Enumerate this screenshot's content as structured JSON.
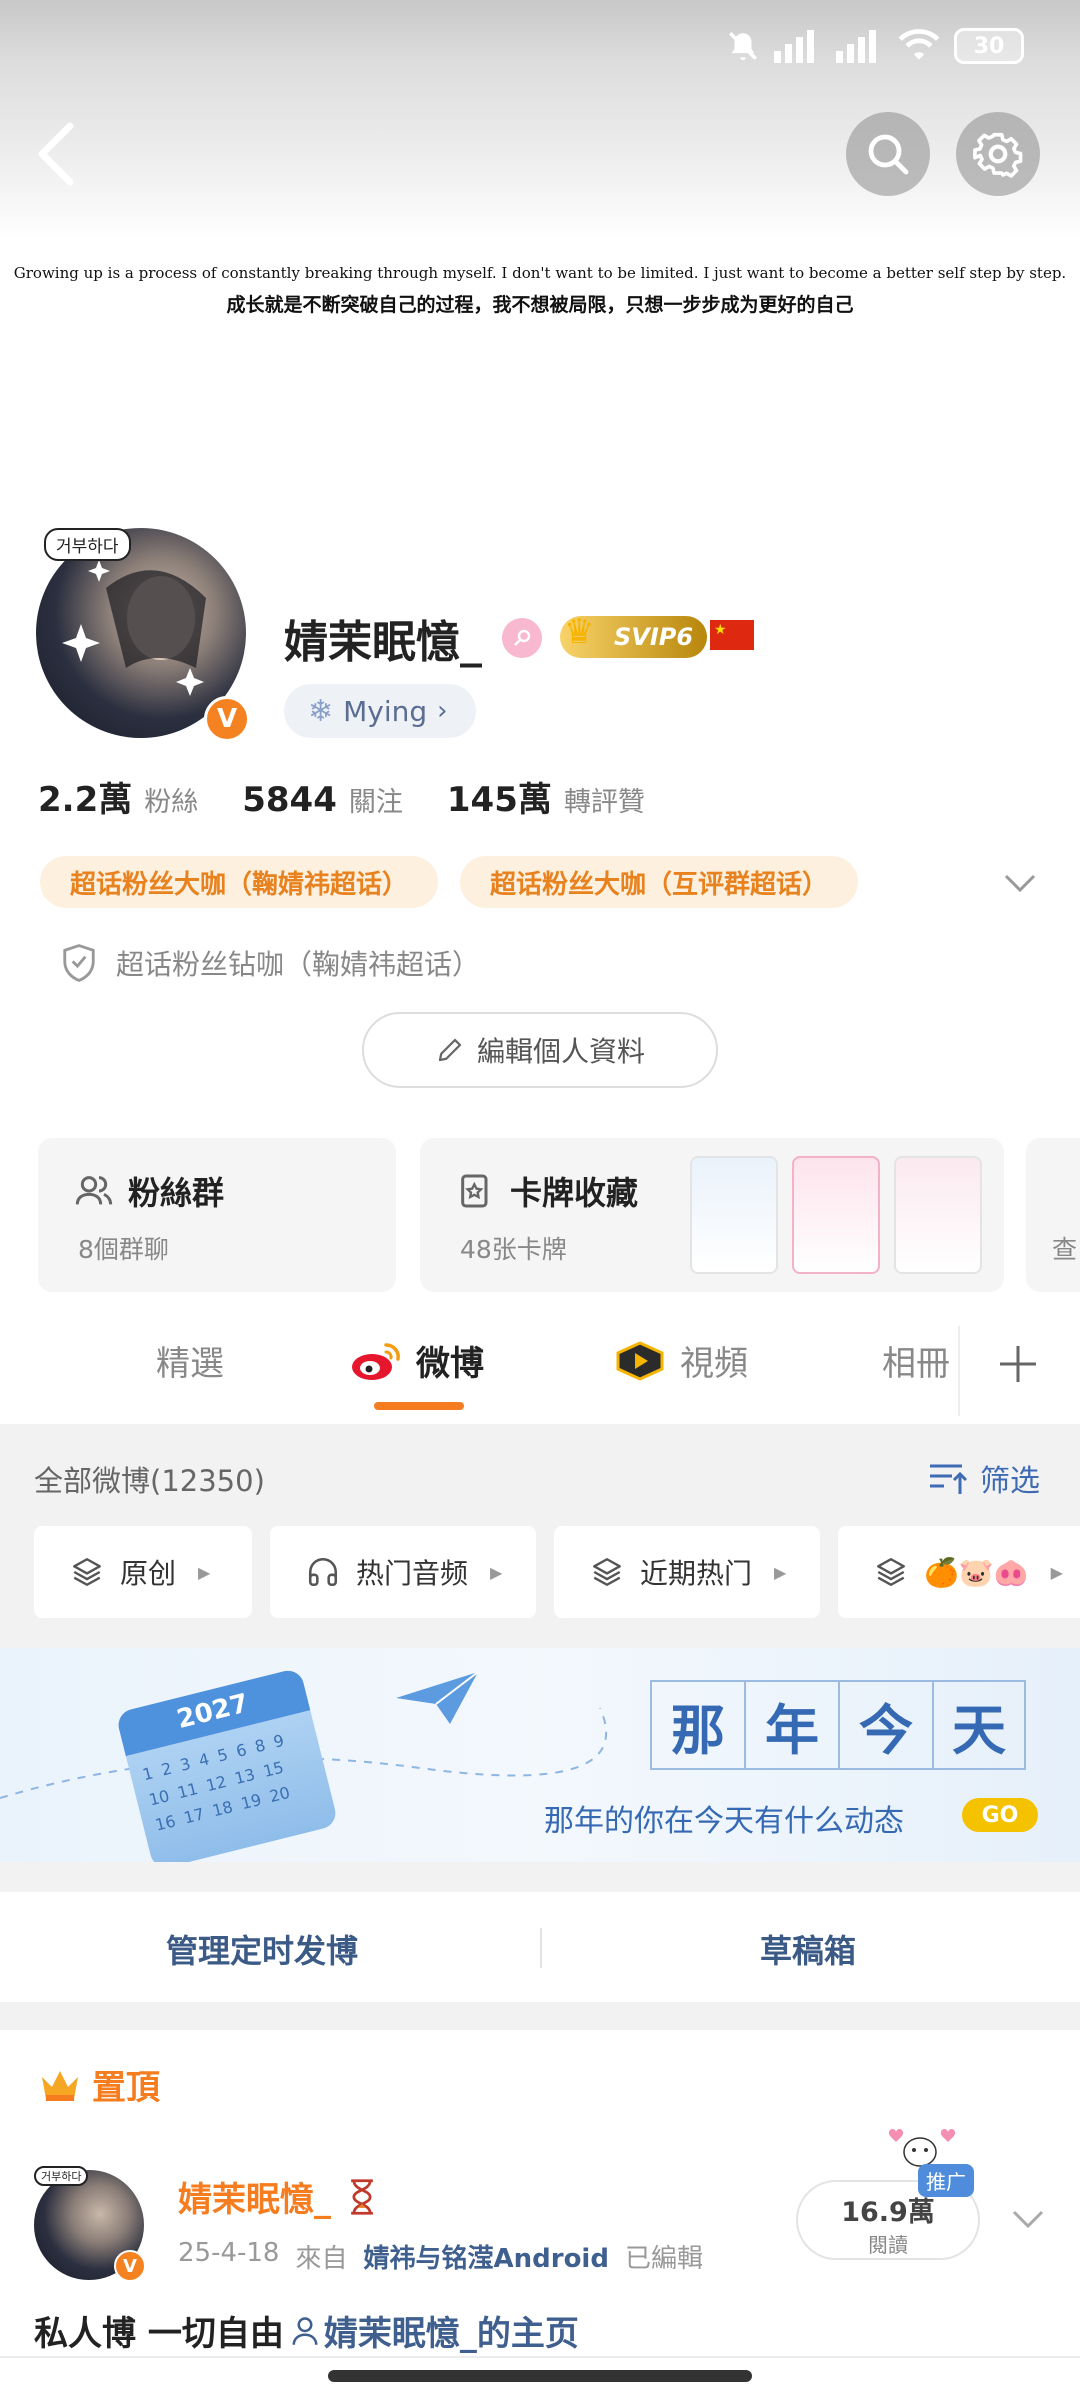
{
  "status": {
    "battery": "30"
  },
  "header": {
    "quote_en": "Growing up is a process of constantly breaking through myself. I don't want to be limited. I just want to become a better self step by step.",
    "quote_cn": "成长就是不断突破自己的过程，我不想被局限，只想一步步成为更好的自己"
  },
  "profile": {
    "avatar_tag": "거부하다",
    "username": "婧茉眠憶_",
    "svip_label": "SVIP6",
    "mying_label": "Mying",
    "stats": [
      {
        "num": "2.2萬",
        "label": "粉絲"
      },
      {
        "num": "5844",
        "label": "關注"
      },
      {
        "num": "145萬",
        "label": "轉評贊"
      }
    ],
    "tags": [
      "超话粉丝大咖（鞠婧祎超话）",
      "超话粉丝大咖（互评群超话）"
    ],
    "shield_label": "超话粉丝钻咖（鞠婧祎超话）",
    "edit_label": "編輯個人資料"
  },
  "cards": {
    "fans": {
      "title": "粉絲群",
      "sub": "8個群聊"
    },
    "collection": {
      "title": "卡牌收藏",
      "sub": "48张卡牌"
    },
    "next_sub": "查"
  },
  "tabs": {
    "items": [
      "精選",
      "微博",
      "視頻",
      "相冊"
    ],
    "active_index": 1
  },
  "feed": {
    "all_posts": "全部微博(12350)",
    "filter_label": "筛选",
    "chips": [
      "原创",
      "热门音频",
      "近期热门",
      "🍊🐷🐽"
    ],
    "promo": {
      "title_chars": [
        "那",
        "年",
        "今",
        "天"
      ],
      "subtitle": "那年的你在今天有什么动态",
      "go": "GO",
      "calendar_year": "2027",
      "calendar_nums": "1 2 3 4 5 6 8 9 10 11 12 13 15 16 17 18 19 20"
    },
    "manage": {
      "left": "管理定时发博",
      "right": "草稿箱"
    }
  },
  "post": {
    "pin_label": "置頂",
    "avatar_tag": "거부하다",
    "name": "婧茉眠憶_",
    "date": "25-4-18",
    "from_label": "來自",
    "source": "婧祎与铭滢Android",
    "edited": "已編輯",
    "reads_num": "16.9萬",
    "reads_label": "閱讀",
    "promo_tag": "推广",
    "text": "私人博 一切自由",
    "link_text": "婧茉眠憶_的主页"
  },
  "colors": {
    "accent": "#f57c1f",
    "link": "#3f5f8f",
    "tag_bg": "#fdf0df"
  }
}
